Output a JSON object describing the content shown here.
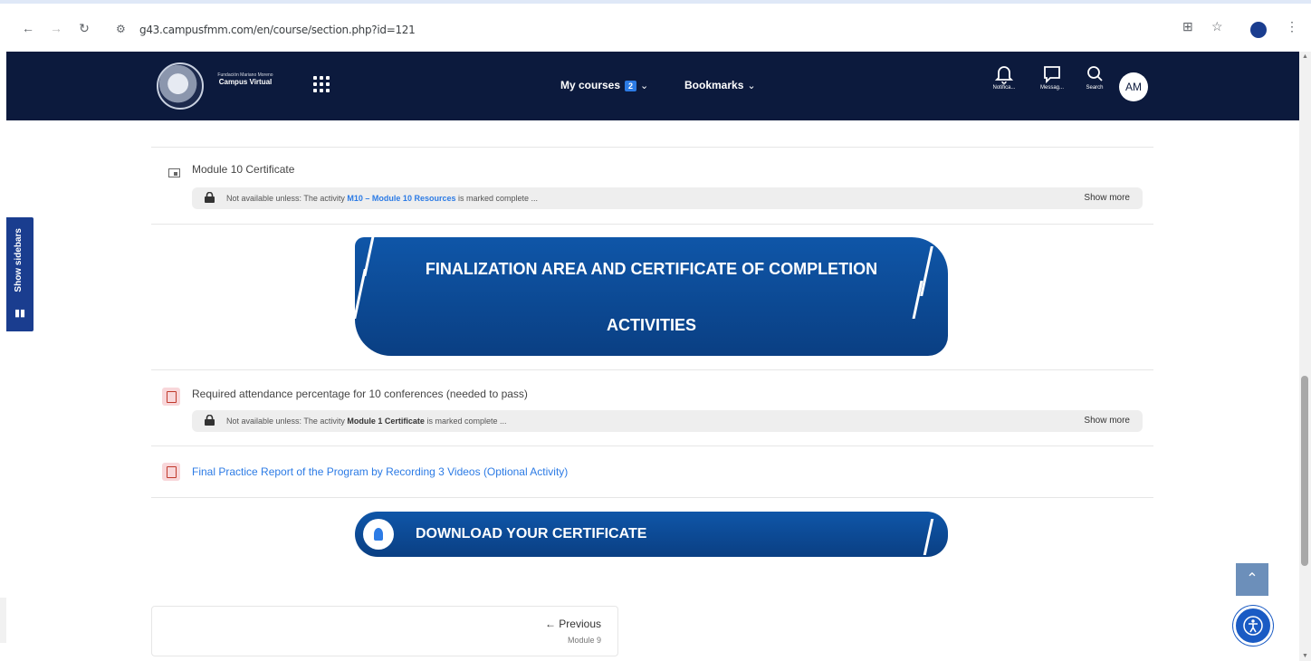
{
  "browser": {
    "url": "g43.campusfmm.com/en/course/section.php?id=121"
  },
  "header": {
    "logo_small": "Fundación Mariano Moreno",
    "logo_big": "Campus Virtual",
    "my_courses_label": "My courses",
    "my_courses_count": "2",
    "bookmarks_label": "Bookmarks",
    "notifications_label": "Notifica...",
    "messages_label": "Messag...",
    "search_label": "Search",
    "avatar_initials": "AM"
  },
  "sidebar_toggle": {
    "label": "Show sidebars"
  },
  "activities": {
    "module10_certificate": {
      "title": "Module 10 Certificate",
      "restriction_prefix": "Not available unless: The activity",
      "restriction_link": "M10 – Module 10 Resources",
      "restriction_suffix": "is marked complete ...",
      "show_more": "Show more"
    },
    "attendance": {
      "title": "Required attendance percentage for 10 conferences (needed to pass)",
      "restriction_prefix": "Not available unless: The activity",
      "restriction_link": "Module 1 Certificate",
      "restriction_suffix": "is marked complete ...",
      "show_more": "Show more"
    },
    "final_report": {
      "title": "Final Practice Report of the Program by Recording 3 Videos (Optional Activity)"
    }
  },
  "banners": {
    "finalization_line1": "FINALIZATION AREA AND CERTIFICATE OF COMPLETION",
    "finalization_line2": "ACTIVITIES",
    "download": "DOWNLOAD YOUR CERTIFICATE"
  },
  "pagination": {
    "previous_label": "← Previous",
    "previous_sub": "Module 9"
  },
  "colors": {
    "header_bg": "#0c1a3d",
    "banner_blue": "#0b4a94",
    "link_blue": "#2c7be5"
  }
}
